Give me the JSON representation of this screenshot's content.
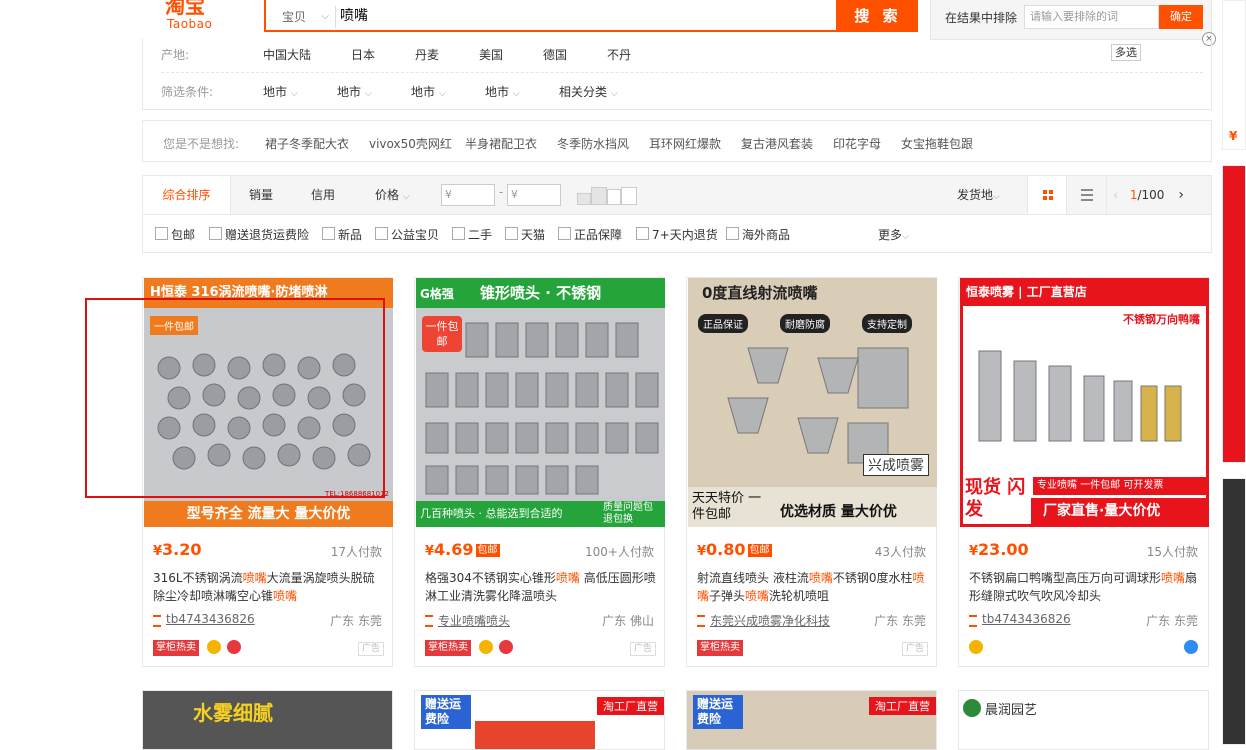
{
  "header": {
    "logo_cn": "淘宝",
    "logo_en": "Taobao",
    "search_scope": "宝贝",
    "search_query": "喷嘴",
    "search_button": "搜 索",
    "exclude_label": "在结果中排除",
    "exclude_placeholder": "请输入要排除的词",
    "exclude_button": "确定"
  },
  "filters": {
    "origin_label": "产地:",
    "origins": [
      "中国大陆",
      "日本",
      "丹麦",
      "美国",
      "德国",
      "不丹"
    ],
    "multi_select": "多选",
    "conditions_label": "筛选条件:",
    "conditions": [
      "地市",
      "地市",
      "地市",
      "地市",
      "相关分类"
    ]
  },
  "suggest": {
    "label": "您是不是想找:",
    "items": [
      "裙子冬季配大衣",
      "vivox50壳网红",
      "半身裙配卫衣",
      "冬季防水挡风",
      "耳环网红爆款",
      "复古港风套装",
      "印花字母",
      "女宝拖鞋包跟"
    ]
  },
  "sortbar": {
    "sorts": [
      "综合排序",
      "销量",
      "信用",
      "价格"
    ],
    "price_min_placeholder": "¥",
    "price_max_placeholder": "¥",
    "ship_from": "发货地",
    "page_current": "1",
    "page_total": "/100"
  },
  "checks": [
    "包邮",
    "赠送退货运费险",
    "新品",
    "公益宝贝",
    "二手",
    "天猫",
    "正品保障",
    "7+天内退货",
    "海外商品"
  ],
  "more": "更多",
  "products": [
    {
      "price_symbol": "¥",
      "price": "3.20",
      "baoyou": "",
      "paid": "17人付款",
      "title_a": "316L不锈钢涡流",
      "title_hl": "喷嘴",
      "title_b": "大流量涡旋喷头脱硫除尘冷却喷淋嘴空心锥",
      "title_hl2": "喷嘴",
      "shop": "tb4743436826",
      "loc": "广东 东莞",
      "badge": "掌柜热卖",
      "ad": "广告",
      "img_top": "H恒泰 316涡流喷嘴·防堵喷淋",
      "img_tag": "一件包邮",
      "img_bottom": "型号齐全 流量大 量大价优",
      "img_tel": "TEL:18688681012"
    },
    {
      "price_symbol": "¥",
      "price": "4.69",
      "baoyou": "包邮",
      "paid": "100+人付款",
      "title_a": "格强304不锈钢实心锥形",
      "title_hl": "喷嘴",
      "title_b": " 高低压圆形喷淋工业清洗雾化降温喷头",
      "title_hl2": "",
      "shop": "专业喷嘴喷头",
      "loc": "广东 佛山",
      "badge": "掌柜热卖",
      "ad": "广告",
      "img_top": "锥形喷头 · 不锈钢",
      "img_brand": "G格强",
      "img_tag": "一件包邮",
      "img_bottom": "几百种喷头 · 总能选到合适的",
      "img_note": "质量问题包退包换"
    },
    {
      "price_symbol": "¥",
      "price": "0.80",
      "baoyou": "包邮",
      "paid": "43人付款",
      "title_a": "射流直线喷头 液柱流",
      "title_hl": "喷嘴",
      "title_b": "不锈钢0度水柱",
      "title_hl2": "喷嘴",
      "title_c": "子弹头",
      "title_hl3": "喷嘴",
      "title_d": "洗轮机喷咀",
      "shop": "东莞兴成喷雾净化科技",
      "loc": "广东 东莞",
      "badge": "掌柜热卖",
      "ad": "广告",
      "img_top": "0度直线射流喷嘴",
      "img_tags": [
        "正品保证",
        "耐磨防腐",
        "支持定制"
      ],
      "img_wm": "兴成喷雾",
      "img_left": "天天特价 一件包邮",
      "img_bottom": "优选材质 量大价优"
    },
    {
      "price_symbol": "¥",
      "price": "23.00",
      "baoyou": "",
      "paid": "15人付款",
      "title_a": "不锈钢扁口鸭嘴型高压万向可调球形",
      "title_hl": "喷嘴",
      "title_b": "扇形缝隙式吹气吹风冷却头",
      "title_hl2": "",
      "shop": "tb4743436826",
      "loc": "广东 东莞",
      "badge": "",
      "ad": "",
      "img_top": "恒泰喷雾 | 工厂直营店",
      "img_sub": "不锈钢万向鸭嘴",
      "img_mid": "专业喷嘴 一件包邮 可开发票",
      "img_left": "现货 闪发",
      "img_bottom": "厂家直售·量大价优"
    }
  ],
  "row2": [
    "水雾细腻",
    "赠送运费险",
    "赠送运费险",
    "晨润园艺"
  ],
  "row2_tag": "淘工厂直营"
}
